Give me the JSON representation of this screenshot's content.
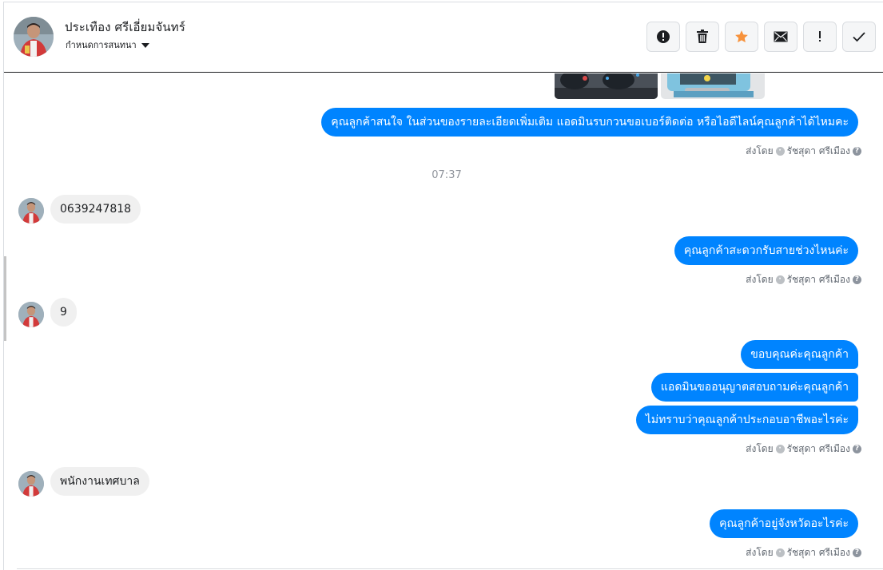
{
  "header": {
    "name": "ประเทือง ศรีเอี่ยมจันทร์",
    "subtitle": "กำหนดการสนทนา"
  },
  "actions": [
    {
      "icon": "alert-circle-icon",
      "label": "!"
    },
    {
      "icon": "trash-icon"
    },
    {
      "icon": "star-icon",
      "color": "#f7923b"
    },
    {
      "icon": "envelope-icon"
    },
    {
      "icon": "exclamation-icon",
      "label": "!"
    },
    {
      "icon": "check-icon"
    }
  ],
  "messages": {
    "m1": "คุณลูกค้าสนใจ ในส่วนของรายละเอียดเพิ่มเติม แอดมินรบกวนขอเบอร์ติดต่อ หรือไอดีไลน์คุณลูกค้าได้ไหมคะ",
    "sent1": "ส่งโดย",
    "agent1": "รัชสุดา ศรีเมือง",
    "time1": "07:37",
    "in1": "0639247818",
    "m2": "คุณลูกค้าสะดวกรับสายช่วงไหนค่ะ",
    "sent2": "ส่งโดย",
    "agent2": "รัชสุดา ศรีเมือง",
    "in2": "9",
    "m3": "ขอบคุณค่ะคุณลูกค้า",
    "m4": "แอดมินขออนุญาตสอบถามค่ะคุณลูกค้า",
    "m5": "ไม่ทราบว่าคุณลูกค้าประกอบอาชีพอะไรค่ะ",
    "sent3": "ส่งโดย",
    "agent3": "รัชสุดา ศรีเมือง",
    "in3": "พนักงานเทศบาล",
    "m6": "คุณลูกค้าอยู่จังหวัดอะไรค่ะ",
    "sent4": "ส่งโดย",
    "agent4": "รัชสุดา ศรีเมือง"
  },
  "colors": {
    "outgoing": "#0084ff",
    "incoming": "#f0f0f0",
    "star": "#f7923b"
  }
}
